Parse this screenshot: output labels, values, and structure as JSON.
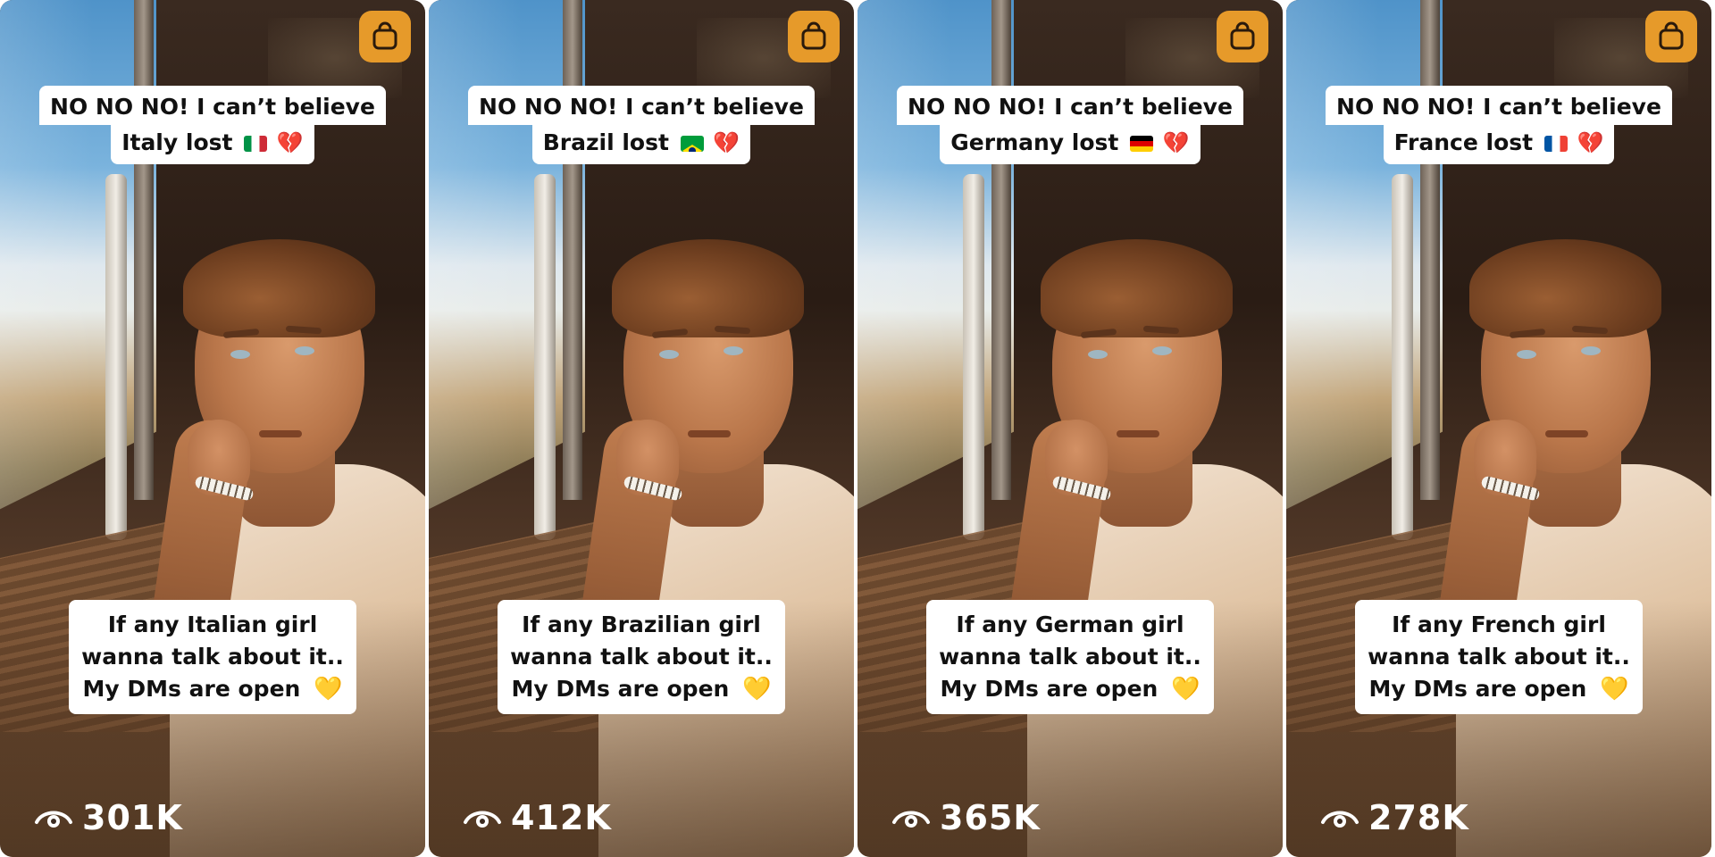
{
  "panels": [
    {
      "line1": "NO NO NO! I can’t believe",
      "line2": "Italy lost",
      "flag_colors": [
        "#009246",
        "#ffffff",
        "#ce2b37"
      ],
      "flag_orientation": "vertical",
      "bottom1": "If any Italian girl",
      "bottom2": "wanna talk about it..",
      "bottom3": "My DMs are open",
      "views": "301K"
    },
    {
      "line1": "NO NO NO! I can’t believe",
      "line2": "Brazil lost",
      "flag_colors": [
        "#009c3b",
        "#ffdf00",
        "#002776"
      ],
      "flag_orientation": "brazil",
      "bottom1": "If any Brazilian girl",
      "bottom2": "wanna talk about it..",
      "bottom3": "My DMs are open",
      "views": "412K"
    },
    {
      "line1": "NO NO NO! I can’t believe",
      "line2": "Germany lost",
      "flag_colors": [
        "#000000",
        "#dd0000",
        "#ffce00"
      ],
      "flag_orientation": "horizontal",
      "bottom1": "If any German girl",
      "bottom2": "wanna talk about it..",
      "bottom3": "My DMs are open",
      "views": "365K"
    },
    {
      "line1": "NO NO NO! I can’t believe",
      "line2": "France lost",
      "flag_colors": [
        "#0055a4",
        "#ffffff",
        "#ef4135"
      ],
      "flag_orientation": "vertical",
      "bottom1": "If any French girl",
      "bottom2": "wanna talk about it..",
      "bottom3": "My DMs are open",
      "views": "278K"
    }
  ],
  "icons": {
    "top_right": "shopping-bag-icon",
    "views": "eye-icon",
    "broken_heart": "💔",
    "yellow_heart": "💛"
  },
  "colors": {
    "bag_accent": "#e69a2a",
    "caption_bg": "#ffffff",
    "caption_text": "#111111",
    "views_text": "#ffffff"
  }
}
